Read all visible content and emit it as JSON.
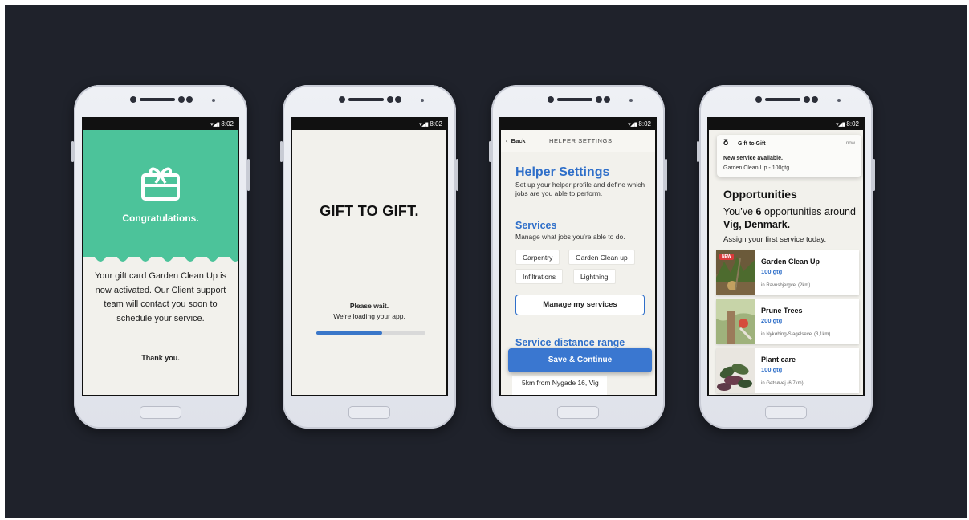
{
  "status_time": "8:02",
  "screen1": {
    "title": "Congratulations.",
    "body": "Your gift card Garden Clean Up is now activated. Our Client support team will contact you soon to schedule your service.",
    "thanks": "Thank you.",
    "colors": {
      "accent": "#4cc39a"
    }
  },
  "screen2": {
    "logo": "GIFT TO GIFT.",
    "wait": "Please wait.",
    "loading": "We’re loading your app.",
    "progress": 0.6
  },
  "screen3": {
    "back": "Back",
    "nav_title": "HELPER SETTINGS",
    "heading": "Helper Settings",
    "intro": "Set up your helper profile and define which jobs are you able to perform.",
    "services_heading": "Services",
    "services_desc": "Manage what jobs you’re able to do.",
    "chips": [
      "Carpentry",
      "Garden Clean up",
      "Infiltrations",
      "Lightning"
    ],
    "manage_button": "Manage my services",
    "distance_heading": "Service distance range",
    "save_button": "Save & Continue",
    "distance_value": "5km from Nygade 16, Vig",
    "colors": {
      "accent": "#2f6fc9"
    }
  },
  "screen4": {
    "notification": {
      "app": "Gift to Gift",
      "time": "now",
      "title": "New service available.",
      "text": "Garden Clean Up - 100gtg."
    },
    "heading": "Opportunities",
    "subtitle_a": "You’ve ",
    "count": "6",
    "subtitle_b": " opportunities around ",
    "place": "Vig, Denmark.",
    "assign": "Assign your first service today.",
    "cards": [
      {
        "title": "Garden Clean Up",
        "price": "100 gtg",
        "location": "in Ravnsbjergvej (2km)",
        "badge": "NEW"
      },
      {
        "title": "Prune Trees",
        "price": "200 gtg",
        "location": "in Nykøbing-Slagelsevej (3,1km)",
        "badge": ""
      },
      {
        "title": "Plant care",
        "price": "100 gtg",
        "location": "in Gøtsøvej (6,7km)",
        "badge": ""
      }
    ]
  }
}
